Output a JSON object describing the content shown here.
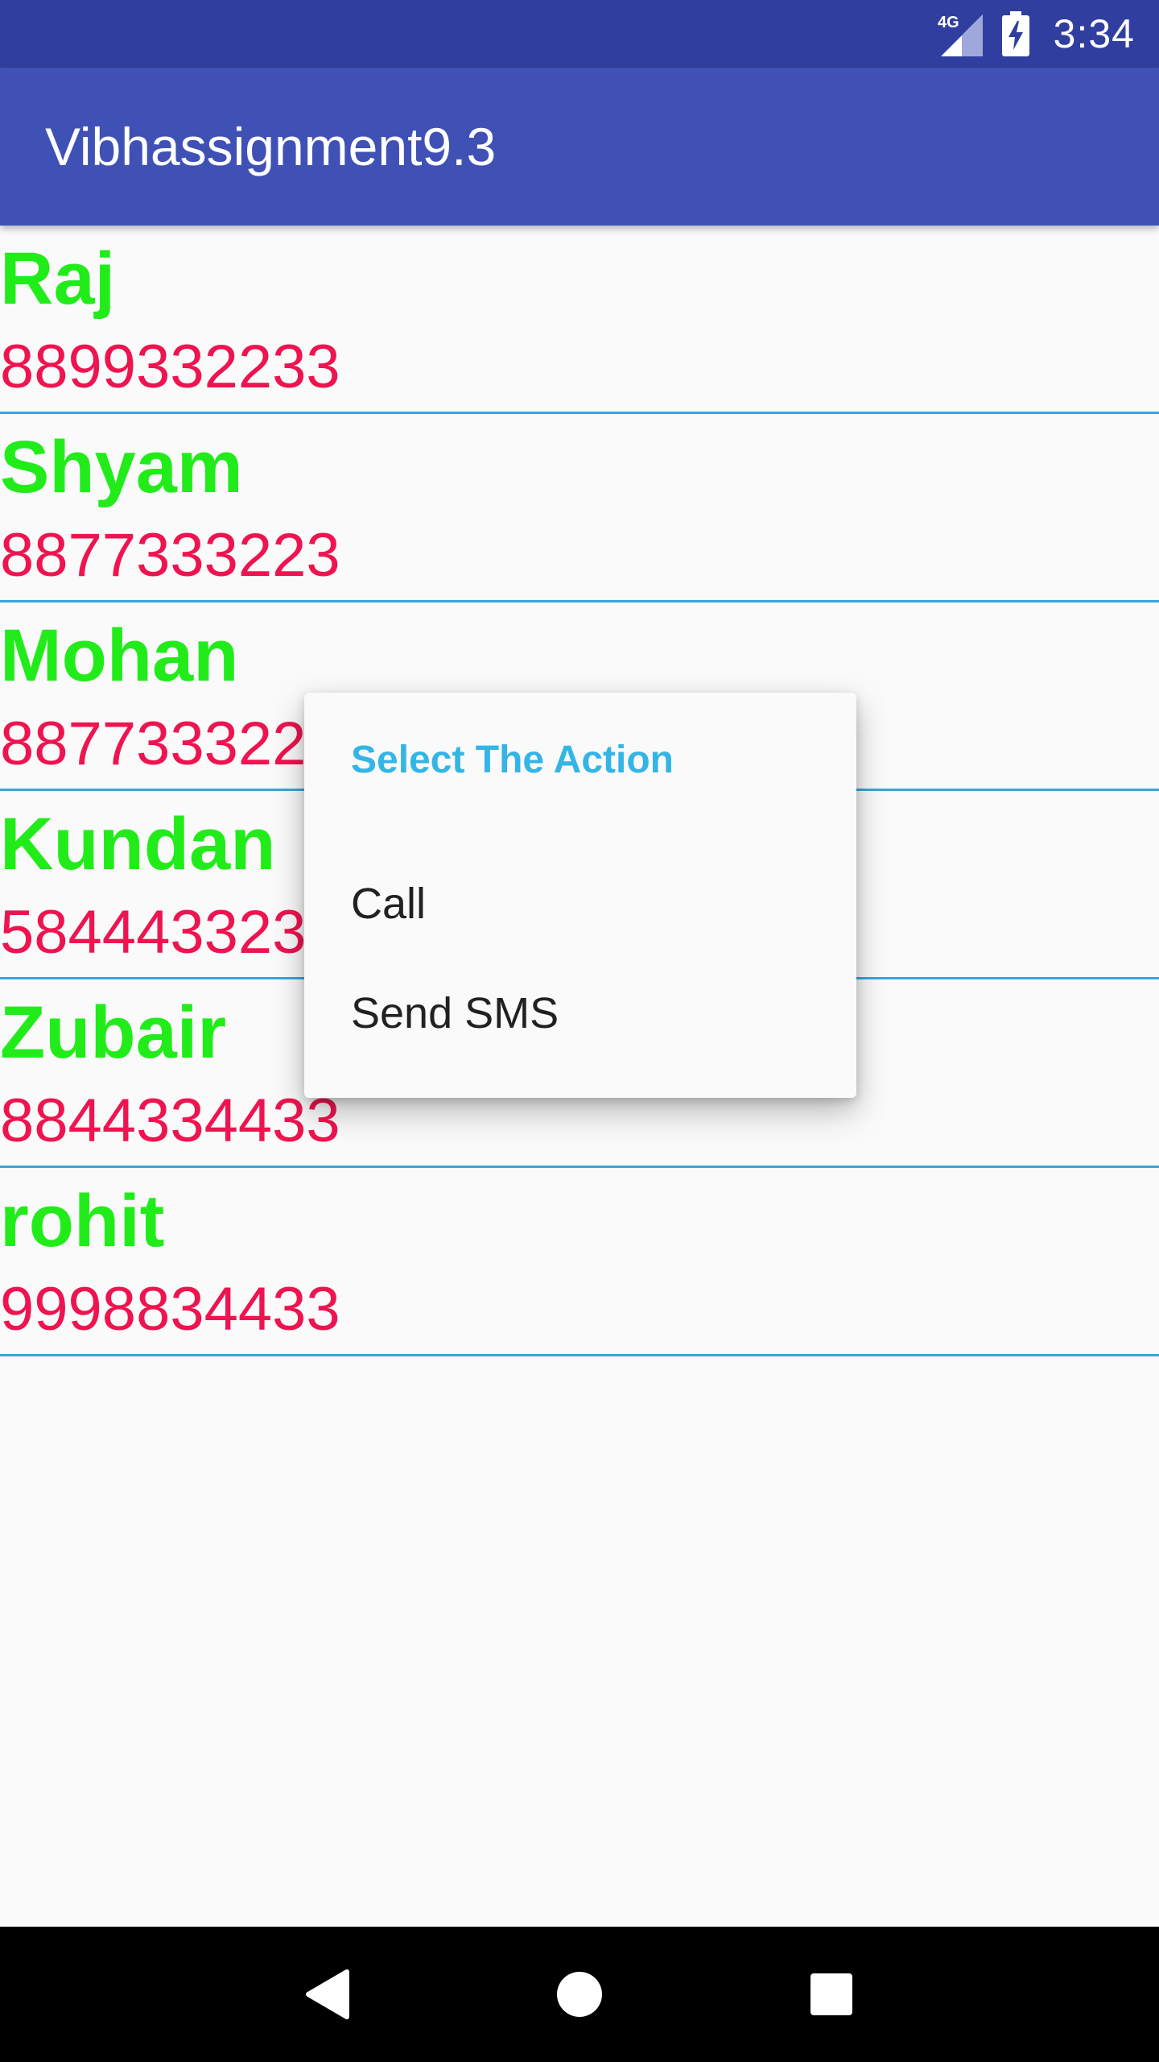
{
  "status_bar": {
    "network": "4G",
    "time": "3:34",
    "icons": [
      "signal-4g-icon",
      "battery-charging-icon"
    ]
  },
  "app_bar": {
    "title": "Vibhassignment9.3",
    "color": "#3f51b5",
    "status_color": "#303f9f"
  },
  "contacts": [
    {
      "name": "Raj",
      "phone": "8899332233"
    },
    {
      "name": "Shyam",
      "phone": "8877333223"
    },
    {
      "name": "Mohan",
      "phone": "8877333223"
    },
    {
      "name": "Kundan",
      "phone": "5844433233"
    },
    {
      "name": "Zubair",
      "phone": "8844334433"
    },
    {
      "name": "rohit",
      "phone": "9998834433"
    }
  ],
  "dialog": {
    "title": "Select The Action",
    "items": [
      "Call",
      "Send SMS"
    ],
    "title_color": "#33b5e5"
  },
  "colors": {
    "name": "#21ec1a",
    "phone": "#ee1450",
    "divider": "#3aa6d9"
  },
  "nav_bar": {
    "icons": [
      "back-icon",
      "home-icon",
      "recents-icon"
    ]
  }
}
